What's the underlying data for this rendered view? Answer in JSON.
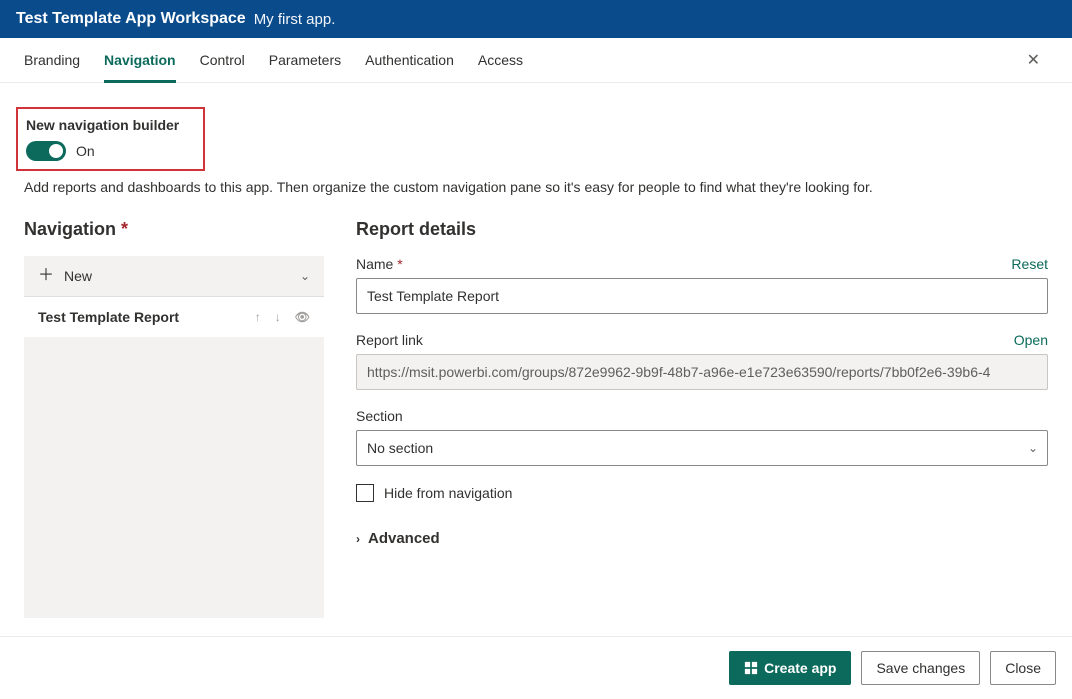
{
  "header": {
    "title": "Test Template App Workspace",
    "subtitle": "My first app."
  },
  "tabs": {
    "items": [
      "Branding",
      "Navigation",
      "Control",
      "Parameters",
      "Authentication",
      "Access"
    ],
    "active": "Navigation"
  },
  "toggle": {
    "label": "New navigation builder",
    "state": "On"
  },
  "description": "Add reports and dashboards to this app. Then organize the custom navigation pane so it's easy for people to find what they're looking for.",
  "navigation": {
    "title": "Navigation",
    "new_label": "New",
    "items": [
      {
        "label": "Test Template Report",
        "selected": true
      }
    ]
  },
  "details": {
    "title": "Report details",
    "name_label": "Name",
    "name_value": "Test Template Report",
    "name_reset": "Reset",
    "link_label": "Report link",
    "link_value": "https://msit.powerbi.com/groups/872e9962-9b9f-48b7-a96e-e1e723e63590/reports/7bb0f2e6-39b6-4",
    "link_open": "Open",
    "section_label": "Section",
    "section_value": "No section",
    "hide_label": "Hide from navigation",
    "advanced_label": "Advanced"
  },
  "footer": {
    "create": "Create app",
    "save": "Save changes",
    "close": "Close"
  }
}
